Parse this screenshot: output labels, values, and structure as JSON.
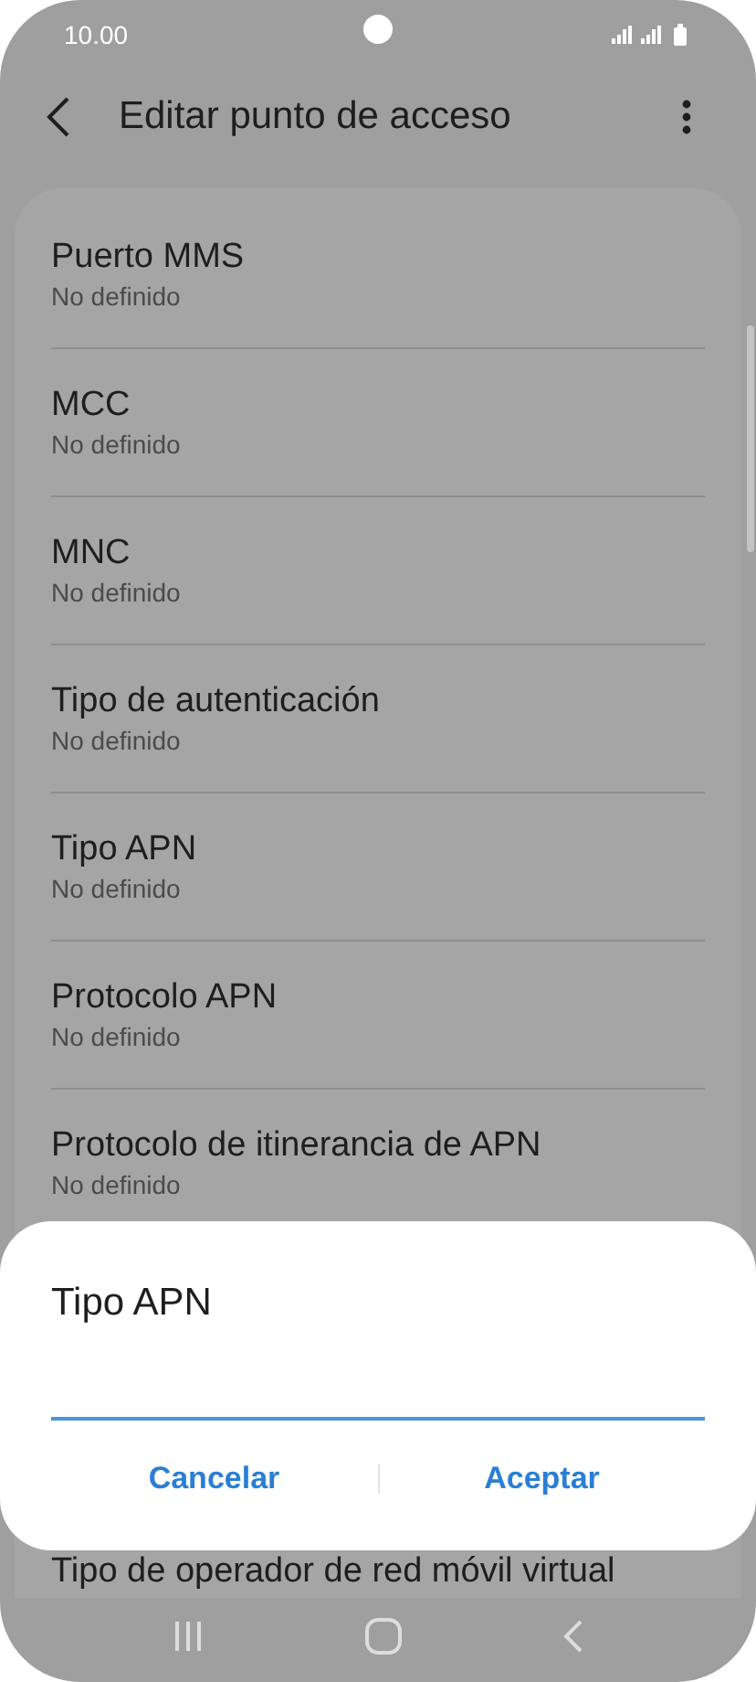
{
  "status_bar": {
    "time": "10.00"
  },
  "header": {
    "title": "Editar punto de acceso"
  },
  "settings": [
    {
      "title": "Puerto MMS",
      "value": "No definido"
    },
    {
      "title": "MCC",
      "value": "No definido"
    },
    {
      "title": "MNC",
      "value": "No definido"
    },
    {
      "title": "Tipo de autenticación",
      "value": "No definido"
    },
    {
      "title": "Tipo APN",
      "value": "No definido"
    },
    {
      "title": "Protocolo APN",
      "value": "No definido"
    },
    {
      "title": "Protocolo de itinerancia de APN",
      "value": "No definido"
    },
    {
      "title": "Tipo de operador de red móvil virtual"
    }
  ],
  "dialog": {
    "title": "Tipo APN",
    "buttons": [
      "Cancelar",
      "Aceptar"
    ]
  }
}
